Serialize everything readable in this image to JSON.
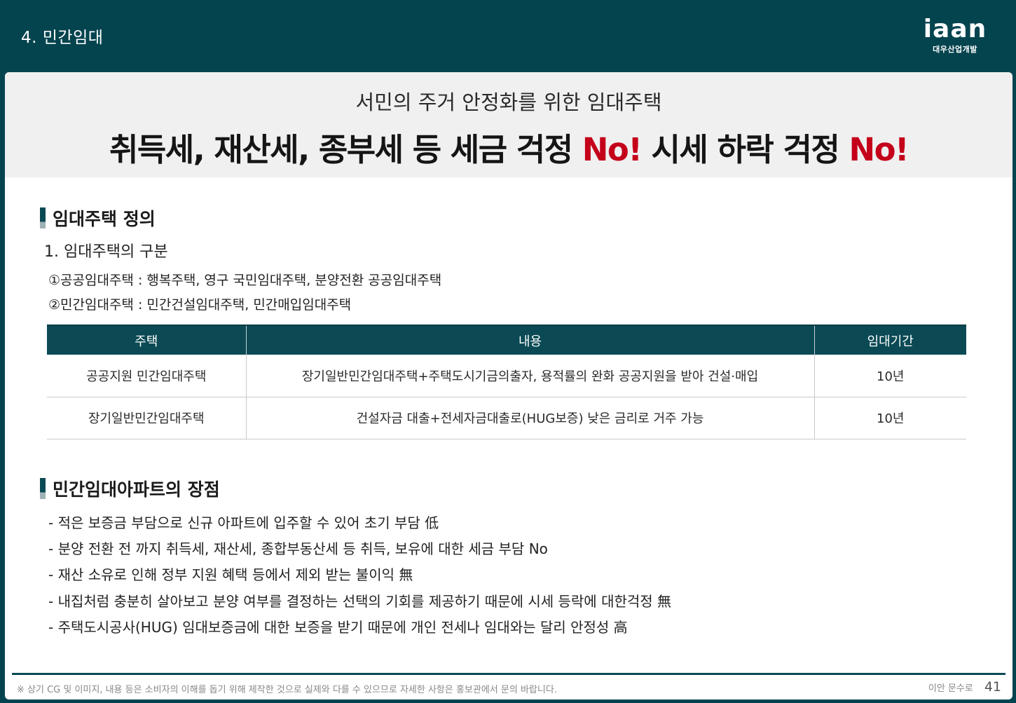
{
  "header": {
    "title": "4. 민간임대",
    "logo_word": "iaan",
    "logo_sub": "대우산업개발"
  },
  "hero": {
    "subtitle": "서민의 주거 안정화를 위한 임대주택",
    "main_part1": "취득세, 재산세, 종부세 등 세금 걱정 ",
    "main_no1": "No!",
    "main_part2": " 시세 하락 걱정 ",
    "main_no2": "No!"
  },
  "definition": {
    "heading": "임대주택 정의",
    "subtitle": "1. 임대주택의 구분",
    "items": [
      "①공공임대주택 : 행복주택, 영구 국민임대주택, 분양전환 공공임대주택",
      "②민간임대주택 : 민간건설임대주택, 민간매입임대주택"
    ]
  },
  "table": {
    "headers": [
      "주택",
      "내용",
      "임대기간"
    ],
    "rows": [
      [
        "공공지원 민간임대주택",
        "장기일반민간임대주택+주택도시기금의출자, 용적률의 완화 공공지원을 받아 건설·매입",
        "10년"
      ],
      [
        "장기일반민간임대주택",
        "건설자금 대출+전세자금대출로(HUG보증) 낮은 금리로 거주 가능",
        "10년"
      ]
    ]
  },
  "advantages": {
    "heading": "민간임대아파트의 장점",
    "items": [
      "- 적은 보증금 부담으로 신규 아파트에 입주할 수 있어 초기 부담 低",
      "- 분양 전환 전 까지 취득세, 재산세, 종합부동산세 등 취득, 보유에 대한 세금 부담 No",
      "- 재산 소유로 인해 정부 지원 혜택 등에서 제외 받는 불이익 無",
      "- 내집처럼 충분히 살아보고 분양 여부를 결정하는 선택의 기회를 제공하기 때문에 시세 등락에 대한걱정 無",
      "- 주택도시공사(HUG) 임대보증금에 대한 보증을 받기 때문에 개인 전세나 임대와는 달리 안정성 高"
    ]
  },
  "footer": {
    "note": "※ 상기 CG 및 이미지, 내용 등은 소비자의 이해를 돕기 위해 제작한 것으로 실제와 다를 수 있으므로 자세한 사항은 홍보관에서 문의 바랍니다.",
    "contact": "이안 문수로",
    "page": "41"
  },
  "colors": {
    "brand_teal": "#04444f",
    "table_header": "#0b4a55",
    "accent_red": "#c4001a"
  }
}
